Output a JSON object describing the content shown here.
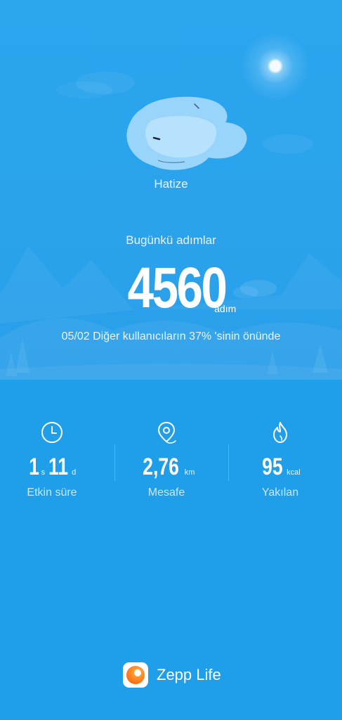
{
  "profile": {
    "name": "Hatize"
  },
  "steps": {
    "caption": "Bugünkü adımlar",
    "value": "4560",
    "unit": "adım",
    "rank_text": "05/02 Diğer kullanıcıların 37% 'sinin önünde"
  },
  "stats": [
    {
      "icon": "clock-icon",
      "value_hours": "1",
      "unit_hours": "s",
      "value_minutes": "11",
      "unit_minutes": "d",
      "label": "Etkin süre"
    },
    {
      "icon": "location-pin-icon",
      "value": "2,76",
      "unit": "km",
      "label": "Mesafe"
    },
    {
      "icon": "flame-icon",
      "value": "95",
      "unit": "kcal",
      "label": "Yakılan"
    }
  ],
  "brand": {
    "name": "Zepp Life",
    "logo_colors": [
      "#ff7a1a",
      "#ffb347"
    ]
  },
  "colors": {
    "background": "#1f9eea",
    "hero_background": "#2aa3ec"
  }
}
